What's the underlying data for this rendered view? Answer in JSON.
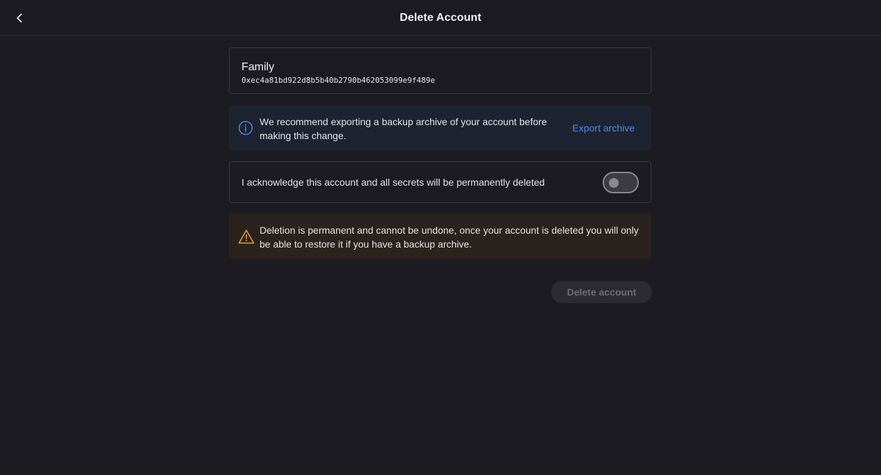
{
  "header": {
    "title": "Delete Account",
    "back_icon": "chevron-left-icon"
  },
  "account": {
    "name": "Family",
    "address": "0xec4a81bd922d8b5b40b2790b462053099e9f489e"
  },
  "info_banner": {
    "icon": "info-icon",
    "message": "We recommend exporting a backup archive of your account before making this change.",
    "action_label": "Export archive",
    "accent_color": "#4d8bf5"
  },
  "acknowledge": {
    "label": "I acknowledge this account and all secrets will be permanently deleted",
    "checked": false
  },
  "warning_banner": {
    "icon": "warning-icon",
    "message": "Deletion is permanent and cannot be undone, once your account is deleted you will only be able to restore it if you have a backup archive.",
    "accent_color": "#e8a33a"
  },
  "actions": {
    "delete_label": "Delete account",
    "delete_enabled": false
  }
}
